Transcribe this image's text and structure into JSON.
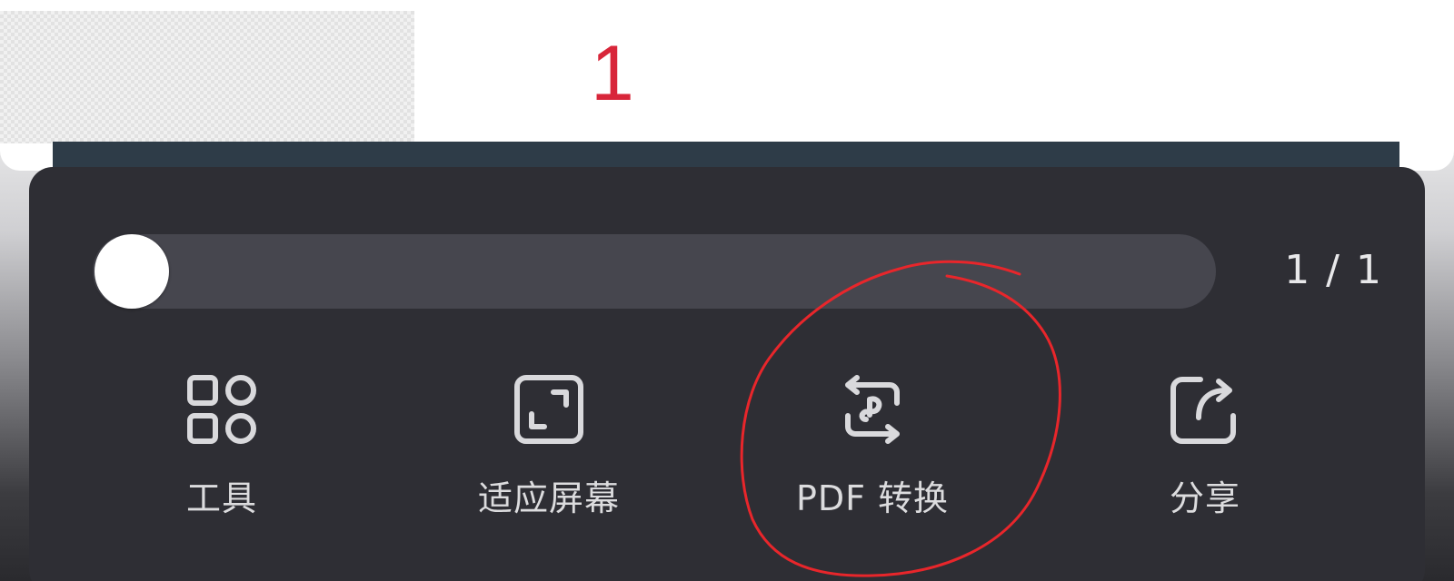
{
  "document": {
    "page_number_mark": "1",
    "accent_color": "#d8263a"
  },
  "toolbar": {
    "slider": {
      "current_page": 1,
      "total_pages": 1,
      "position_fraction": 0
    },
    "page_indicator": "1 / 1",
    "actions": [
      {
        "label": "工具",
        "icon": "grid-tools-icon"
      },
      {
        "label": "适应屏幕",
        "icon": "fit-screen-icon"
      },
      {
        "label": "PDF 转换",
        "icon": "pdf-convert-icon"
      },
      {
        "label": "分享",
        "icon": "share-icon"
      }
    ]
  },
  "annotation": {
    "type": "hand-drawn circle",
    "color": "#e8262b",
    "target": "PDF 转换"
  }
}
